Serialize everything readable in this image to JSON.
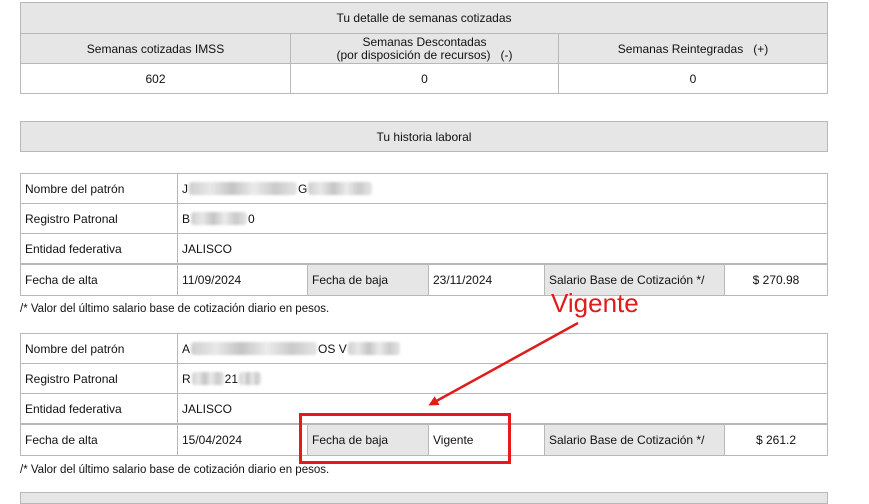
{
  "semanas": {
    "title": "Tu detalle de semanas cotizadas",
    "headers": {
      "cotizadas": "Semanas cotizadas IMSS",
      "descontadas_line1": "Semanas Descontadas",
      "descontadas_line2": "(por disposición de recursos)   (-)",
      "reintegradas": "Semanas Reintegradas   (+)"
    },
    "values": {
      "cotizadas": "602",
      "descontadas": "0",
      "reintegradas": "0"
    }
  },
  "historia": {
    "title": "Tu historia laboral",
    "labels": {
      "nombre": "Nombre del patrón",
      "registro": "Registro Patronal",
      "entidad": "Entidad federativa",
      "fecha_alta": "Fecha de alta",
      "fecha_baja": "Fecha de baja",
      "salario": "Salario Base de Cotización */"
    },
    "footnote": "/* Valor del último salario base de cotización diario en pesos.",
    "records": [
      {
        "nombre_visible": [
          "J",
          "G"
        ],
        "registro_visible": [
          "B",
          "0"
        ],
        "entidad": "JALISCO",
        "fecha_alta": "11/09/2024",
        "fecha_baja": "23/11/2024",
        "salario": "$ 270.98"
      },
      {
        "nombre_visible": [
          "A",
          "OS V"
        ],
        "registro_visible": [
          "R",
          "21"
        ],
        "entidad": "JALISCO",
        "fecha_alta": "15/04/2024",
        "fecha_baja": "Vigente",
        "salario": "$ 261.2"
      }
    ]
  },
  "annotation": {
    "text": "Vigente",
    "color": "#e01b1b"
  }
}
